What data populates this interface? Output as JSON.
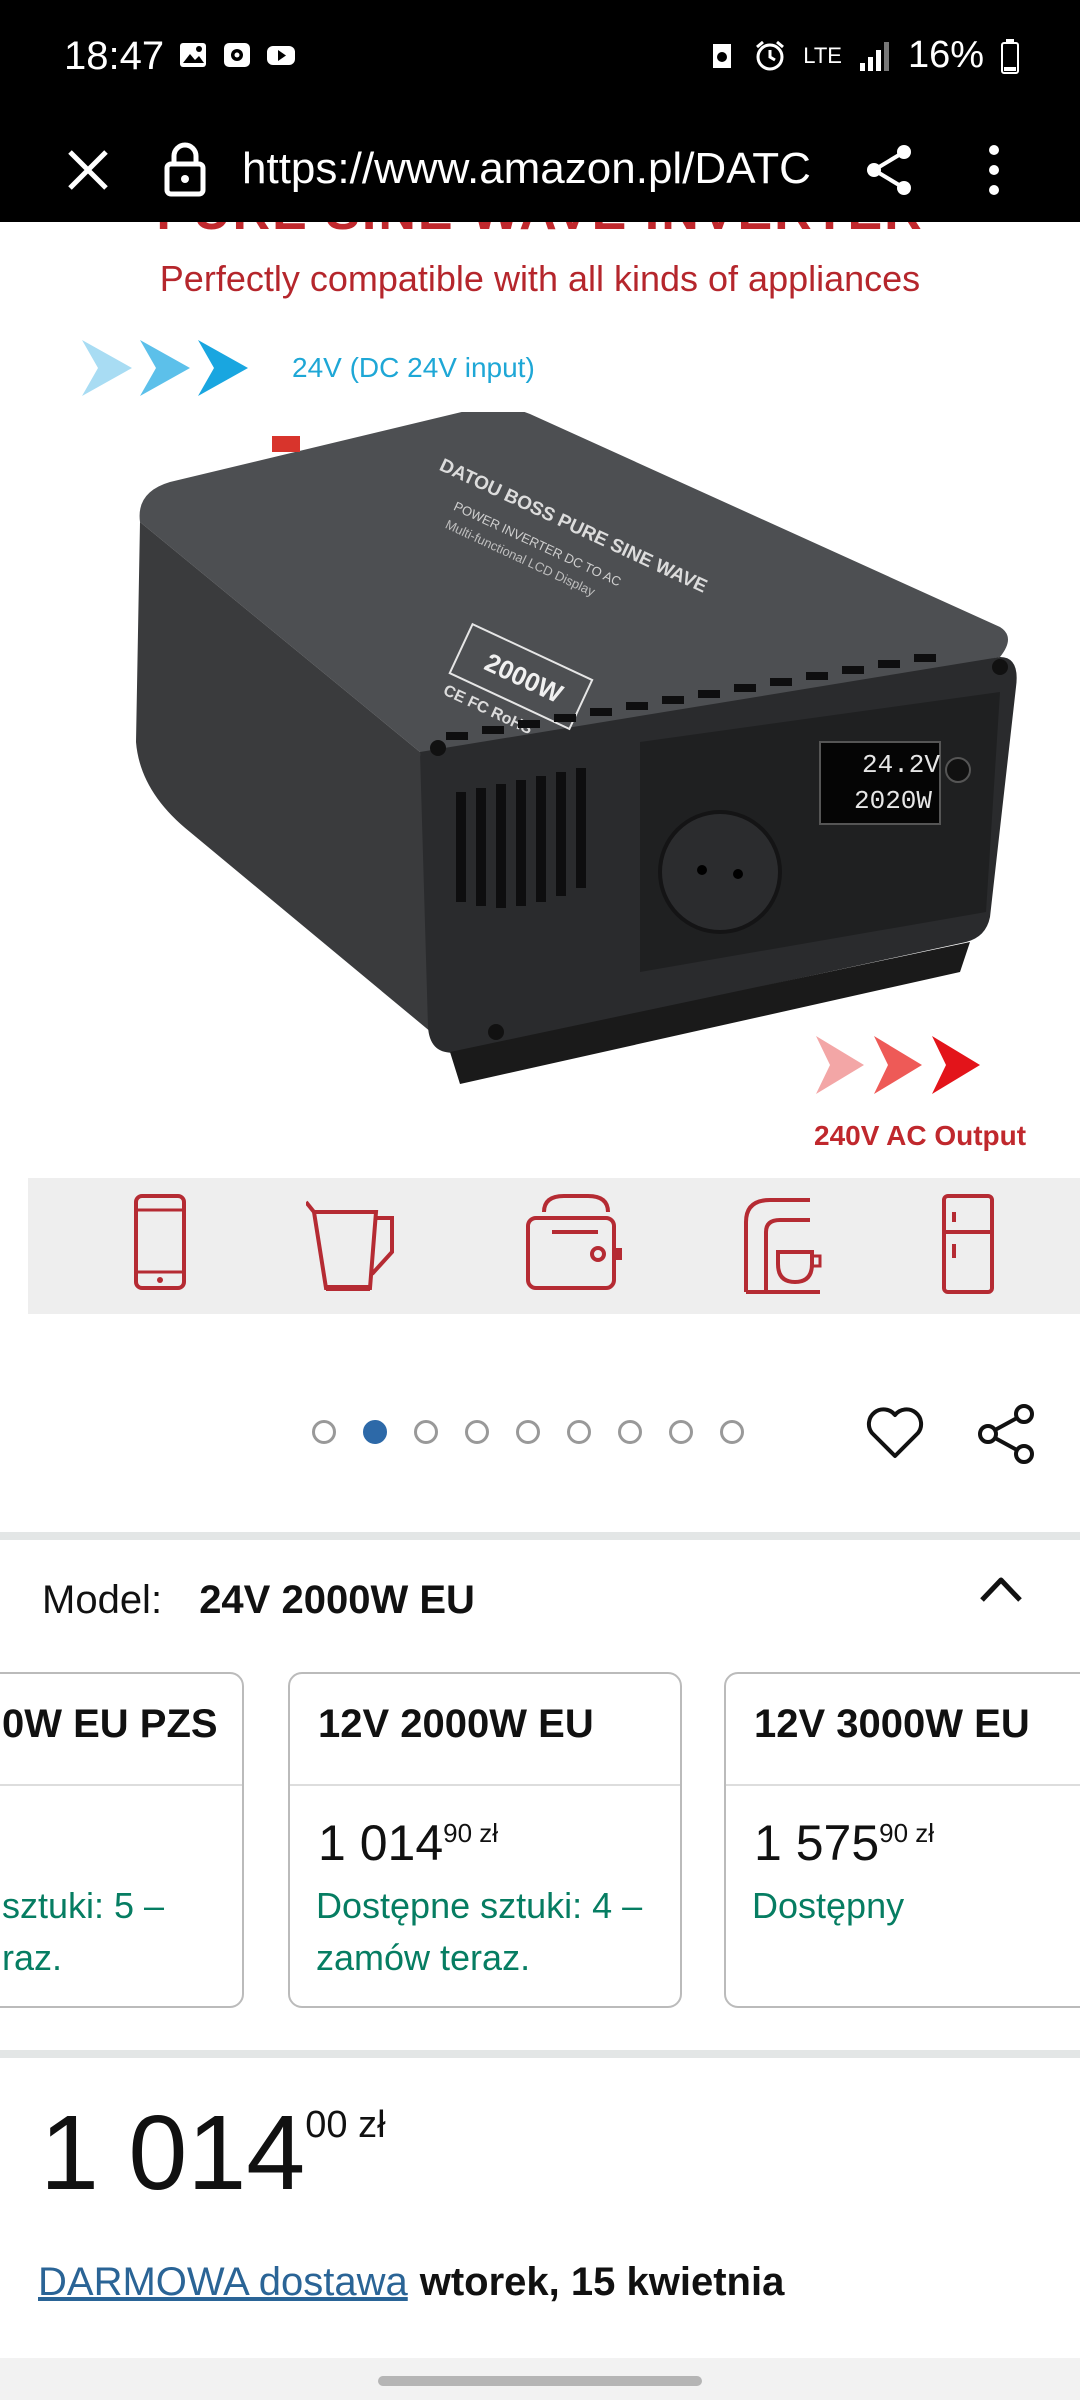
{
  "status_bar": {
    "time": "18:47",
    "network": "LTE",
    "battery": "16%"
  },
  "url_bar": {
    "url": "https://www.amazon.pl/DATC"
  },
  "product_image": {
    "banner_title": "PURE SINE WAVE INVERTER",
    "banner_subtitle": "Perfectly compatible with all kinds of appliances",
    "input_label": "24V (DC 24V input)",
    "output_label": "240V AC Output",
    "device_brand": "DATOU BOSS  PURE SINE WAVE",
    "device_line1": "POWER INVERTER  DC TO AC",
    "device_line2": "Multi-functional LCD Display",
    "device_badge": "2000W",
    "device_certs": "CE FC RoHS",
    "lcd_voltage": "24.2V",
    "lcd_power": "2020W"
  },
  "gallery": {
    "total_images": 9,
    "active_index": 1
  },
  "model": {
    "label": "Model:",
    "value": "24V 2000W EU"
  },
  "options": [
    {
      "title": "0W EU PZS",
      "price_main": "",
      "price_frac": "",
      "availability": "sztuki: 5 – raz."
    },
    {
      "title": "12V 2000W EU",
      "price_main": "1 014",
      "price_frac": "90 zł",
      "availability": "Dostępne sztuki: 4 – zamów teraz."
    },
    {
      "title": "12V 3000W EU",
      "price_main": "1 575",
      "price_frac": "90 zł",
      "availability": "Dostępny"
    }
  ],
  "price": {
    "main": "1 014",
    "fraction": "00 zł"
  },
  "delivery": {
    "link": "DARMOWA dostawa",
    "date": "wtorek, 15 kwietnia"
  },
  "colors": {
    "accent_blue": "#2d69a8",
    "availability_green": "#067d62",
    "banner_red": "#c0282d"
  }
}
